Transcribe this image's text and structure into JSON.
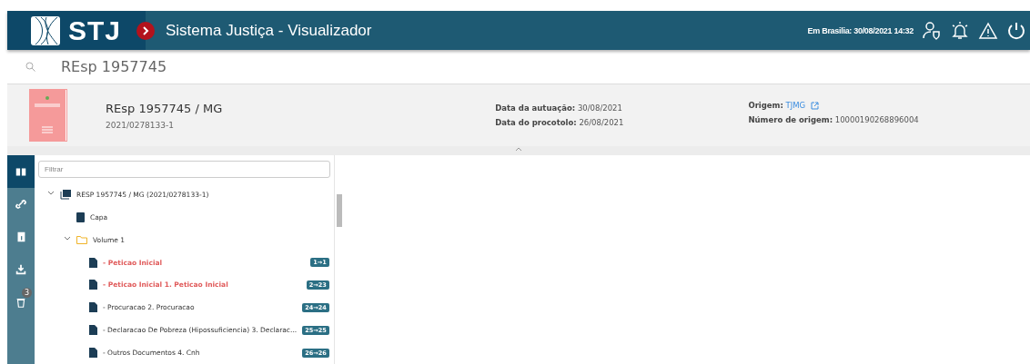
{
  "header": {
    "logo": "STJ",
    "title": "Sistema Justiça - Visualizador",
    "datetime": "Em Brasilia: 30/08/2021 14:32"
  },
  "search": {
    "value": "REsp 1957745"
  },
  "process": {
    "title": "REsp 1957745 / MG",
    "number": "2021/0278133-1",
    "dates": [
      {
        "label": "Data da autuação:",
        "value": "30/08/2021"
      },
      {
        "label": "Data do procotolo:",
        "value": "26/08/2021"
      }
    ],
    "origin": {
      "label": "Origem:",
      "value": "TJMG"
    },
    "origin_number": {
      "label": "Número de origem:",
      "value": "10000190268896004"
    }
  },
  "sidebar": {
    "items": [
      {
        "kind": "book",
        "selected": true
      },
      {
        "kind": "link",
        "selected": false
      },
      {
        "kind": "info",
        "selected": false
      },
      {
        "kind": "download",
        "selected": false
      },
      {
        "kind": "trash",
        "selected": false,
        "badge": "3"
      }
    ]
  },
  "tree": {
    "filter": {
      "placeholder": "Filtrar"
    },
    "root": {
      "label": "RESP 1957745 / MG (2021/0278133-1)",
      "expanded": true,
      "children": [
        {
          "kind": "cover",
          "label": "Capa"
        },
        {
          "kind": "folder",
          "label": "Volume 1",
          "expanded": true,
          "children": [
            {
              "kind": "document",
              "label": "- Peticao Inicial",
              "pages": "1→1",
              "unread": true
            },
            {
              "kind": "document",
              "label": "- Peticao Inicial 1. Peticao Inicial",
              "pages": "2→23",
              "unread": true
            },
            {
              "kind": "document",
              "label": "- Procuracao 2. Procuracao",
              "pages": "24→24",
              "unread": false
            },
            {
              "kind": "document",
              "label": "- Declaracao De Pobreza (Hipossuficiencia) 3. Declarac...",
              "pages": "25→25",
              "unread": false
            },
            {
              "kind": "document",
              "label": "- Outros Documentos 4. Cnh",
              "pages": "26→26",
              "unread": false
            }
          ]
        }
      ]
    }
  }
}
